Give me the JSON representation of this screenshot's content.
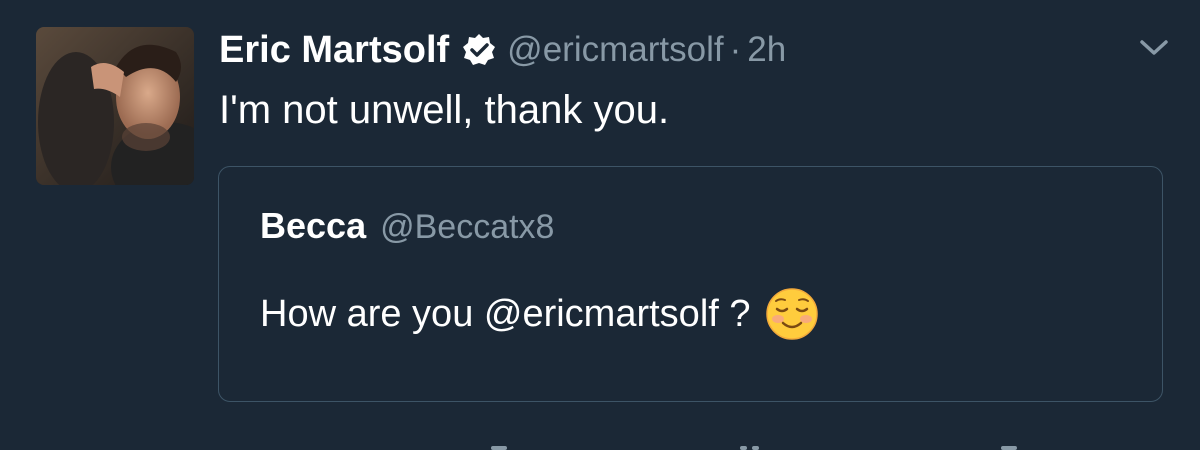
{
  "tweet": {
    "author_name": "Eric Martsolf",
    "author_handle": "@ericmartsolf",
    "separator": "·",
    "timestamp": "2h",
    "text": "I'm not unwell, thank you.",
    "verified": true,
    "avatar_icon": "user-avatar-photo",
    "menu_icon": "chevron-down-icon"
  },
  "quoted_tweet": {
    "author_name": "Becca",
    "author_handle": "@Beccatx8",
    "text": "How are you @ericmartsolf ?",
    "emoji_icon": "smiling-face-emoji"
  },
  "actions": {
    "icons": [
      "reply-icon",
      "retweet-icon",
      "like-icon",
      "share-icon"
    ]
  },
  "colors": {
    "background": "#1b2836",
    "text_primary": "#ffffff",
    "text_secondary": "#8899a6",
    "border": "#3d5466",
    "verified_badge": "#ffffff"
  }
}
